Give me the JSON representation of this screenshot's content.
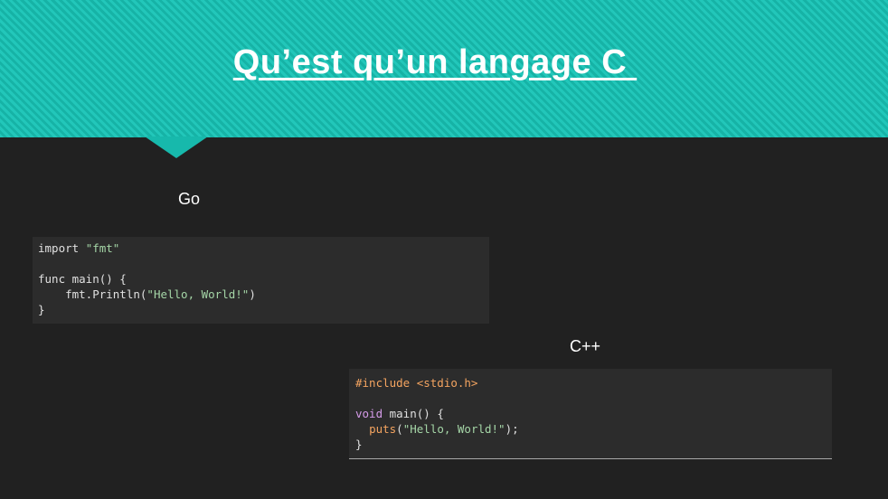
{
  "slide": {
    "title": "Qu’est qu’un langage C ",
    "colors": {
      "band": "#1ec0b3",
      "background": "#212121",
      "code_background": "#2c2c2c",
      "string": "#a5d6a7",
      "preprocessor": "#f4a460",
      "keyword": "#d59be8"
    }
  },
  "go": {
    "label": "Go",
    "line1_kw": "import ",
    "line1_str": "\"fmt\"",
    "line3": "func main() {",
    "line4_pre": "    fmt.Println(",
    "line4_str": "\"Hello, World!\"",
    "line4_post": ")",
    "line5": "}"
  },
  "cpp": {
    "label": "C++",
    "line1_pp": "#include <stdio.h>",
    "line3_kw": "void",
    "line3_rest": " main() {",
    "line4_indent": "  ",
    "line4_fn": "puts",
    "line4_open": "(",
    "line4_str": "\"Hello, World!\"",
    "line4_close": ");",
    "line5": "}"
  }
}
